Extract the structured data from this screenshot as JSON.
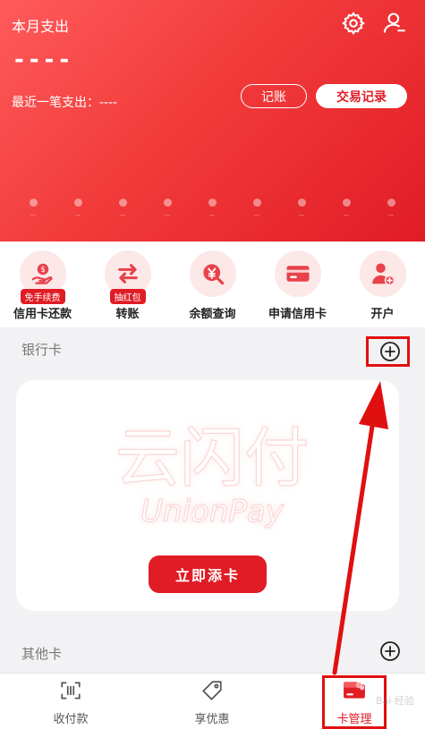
{
  "header": {
    "title": "本月支出",
    "amount": "----",
    "last_expense": "最近一笔支出：----",
    "bookkeeping_button": "记账",
    "records_button": "交易记录",
    "icons": [
      "gear-icon",
      "user-icon"
    ],
    "dot_labels": [
      "--",
      "--",
      "--",
      "--",
      "--",
      "--",
      "--",
      "--",
      "--"
    ]
  },
  "quick_menu": {
    "items": [
      {
        "label": "信用卡还款",
        "badge": "免手续费",
        "icon": "hand-coin-icon"
      },
      {
        "label": "转账",
        "badge": "抽红包",
        "icon": "transfer-arrows-icon"
      },
      {
        "label": "余额查询",
        "badge": "",
        "icon": "yuan-search-icon"
      },
      {
        "label": "申请信用卡",
        "badge": "",
        "icon": "credit-card-icon"
      },
      {
        "label": "开户",
        "badge": "",
        "icon": "user-add-icon"
      }
    ]
  },
  "bank_cards": {
    "title": "银行卡",
    "logo_cn": "云闪付",
    "logo_en": "UnionPay",
    "add_button": "立即添卡"
  },
  "other_cards": {
    "title": "其他卡"
  },
  "bottom_nav": {
    "items": [
      {
        "label": "收付款",
        "icon": "scan-icon"
      },
      {
        "label": "享优惠",
        "icon": "tag-icon"
      },
      {
        "label": "卡管理",
        "icon": "cards-icon"
      }
    ],
    "active_index": 2
  },
  "colors": {
    "brand_red": "#e01c25",
    "annotation_red": "#e01010"
  }
}
